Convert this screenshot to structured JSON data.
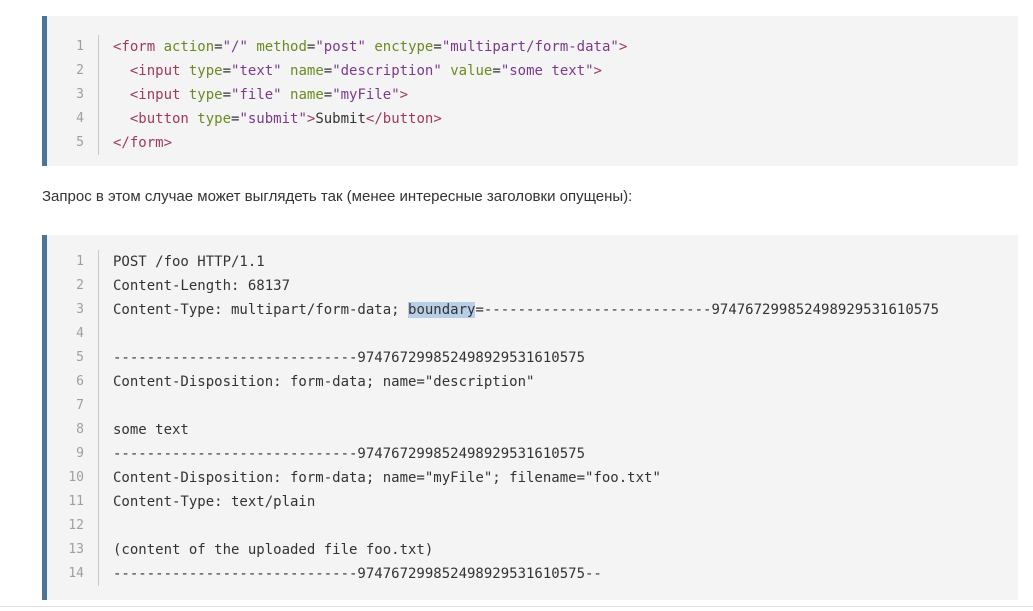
{
  "html_block": {
    "lines": [
      {
        "num": "1",
        "parts": [
          {
            "t": "tag",
            "v": "<form "
          },
          {
            "t": "attr",
            "v": "action"
          },
          {
            "t": "plain",
            "v": "="
          },
          {
            "t": "str",
            "v": "\"/\""
          },
          {
            "t": "plain",
            "v": " "
          },
          {
            "t": "attr",
            "v": "method"
          },
          {
            "t": "plain",
            "v": "="
          },
          {
            "t": "str",
            "v": "\"post\""
          },
          {
            "t": "plain",
            "v": " "
          },
          {
            "t": "attr",
            "v": "enctype"
          },
          {
            "t": "plain",
            "v": "="
          },
          {
            "t": "str",
            "v": "\"multipart/form-data\""
          },
          {
            "t": "tag",
            "v": ">"
          }
        ]
      },
      {
        "num": "2",
        "parts": [
          {
            "t": "plain",
            "v": "  "
          },
          {
            "t": "tag",
            "v": "<input "
          },
          {
            "t": "attr",
            "v": "type"
          },
          {
            "t": "plain",
            "v": "="
          },
          {
            "t": "str",
            "v": "\"text\""
          },
          {
            "t": "plain",
            "v": " "
          },
          {
            "t": "attr",
            "v": "name"
          },
          {
            "t": "plain",
            "v": "="
          },
          {
            "t": "str",
            "v": "\"description\""
          },
          {
            "t": "plain",
            "v": " "
          },
          {
            "t": "attr",
            "v": "value"
          },
          {
            "t": "plain",
            "v": "="
          },
          {
            "t": "str",
            "v": "\"some text\""
          },
          {
            "t": "tag",
            "v": ">"
          }
        ]
      },
      {
        "num": "3",
        "parts": [
          {
            "t": "plain",
            "v": "  "
          },
          {
            "t": "tag",
            "v": "<input "
          },
          {
            "t": "attr",
            "v": "type"
          },
          {
            "t": "plain",
            "v": "="
          },
          {
            "t": "str",
            "v": "\"file\""
          },
          {
            "t": "plain",
            "v": " "
          },
          {
            "t": "attr",
            "v": "name"
          },
          {
            "t": "plain",
            "v": "="
          },
          {
            "t": "str",
            "v": "\"myFile\""
          },
          {
            "t": "tag",
            "v": ">"
          }
        ]
      },
      {
        "num": "4",
        "parts": [
          {
            "t": "plain",
            "v": "  "
          },
          {
            "t": "tag",
            "v": "<button "
          },
          {
            "t": "attr",
            "v": "type"
          },
          {
            "t": "plain",
            "v": "="
          },
          {
            "t": "str",
            "v": "\"submit\""
          },
          {
            "t": "tag",
            "v": ">"
          },
          {
            "t": "plain",
            "v": "Submit"
          },
          {
            "t": "tag",
            "v": "</button>"
          }
        ]
      },
      {
        "num": "5",
        "parts": [
          {
            "t": "tag",
            "v": "</form>"
          }
        ]
      }
    ]
  },
  "prose": "Запрос в этом случае может выглядеть так (менее интересные заголовки опущены):",
  "http_block": {
    "lines": [
      {
        "num": "1",
        "parts": [
          {
            "t": "plain",
            "v": "POST /foo HTTP/1.1"
          }
        ]
      },
      {
        "num": "2",
        "parts": [
          {
            "t": "plain",
            "v": "Content-Length: 68137"
          }
        ]
      },
      {
        "num": "3",
        "parts": [
          {
            "t": "plain",
            "v": "Content-Type: multipart/form-data; "
          },
          {
            "t": "hl",
            "v": "boundary"
          },
          {
            "t": "plain",
            "v": "=---------------------------974767299852498929531610575"
          }
        ]
      },
      {
        "num": "4",
        "parts": [
          {
            "t": "plain",
            "v": ""
          }
        ]
      },
      {
        "num": "5",
        "parts": [
          {
            "t": "plain",
            "v": "-----------------------------974767299852498929531610575"
          }
        ]
      },
      {
        "num": "6",
        "parts": [
          {
            "t": "plain",
            "v": "Content-Disposition: form-data; name=\"description\""
          }
        ]
      },
      {
        "num": "7",
        "parts": [
          {
            "t": "plain",
            "v": ""
          }
        ]
      },
      {
        "num": "8",
        "parts": [
          {
            "t": "plain",
            "v": "some text"
          }
        ]
      },
      {
        "num": "9",
        "parts": [
          {
            "t": "plain",
            "v": "-----------------------------974767299852498929531610575"
          }
        ]
      },
      {
        "num": "10",
        "parts": [
          {
            "t": "plain",
            "v": "Content-Disposition: form-data; name=\"myFile\"; filename=\"foo.txt\""
          }
        ]
      },
      {
        "num": "11",
        "parts": [
          {
            "t": "plain",
            "v": "Content-Type: text/plain"
          }
        ]
      },
      {
        "num": "12",
        "parts": [
          {
            "t": "plain",
            "v": ""
          }
        ]
      },
      {
        "num": "13",
        "parts": [
          {
            "t": "plain",
            "v": "(content of the uploaded file foo.txt)"
          }
        ]
      },
      {
        "num": "14",
        "parts": [
          {
            "t": "plain",
            "v": "-----------------------------974767299852498929531610575--"
          }
        ]
      }
    ]
  },
  "colors": {
    "block_background": "#f4f4f4",
    "block_accent_border": "#4a7596",
    "tag": "#a03a5a",
    "attribute": "#6b8a22",
    "string": "#7a3a8c",
    "selection_highlight": "#b9cfe8"
  }
}
